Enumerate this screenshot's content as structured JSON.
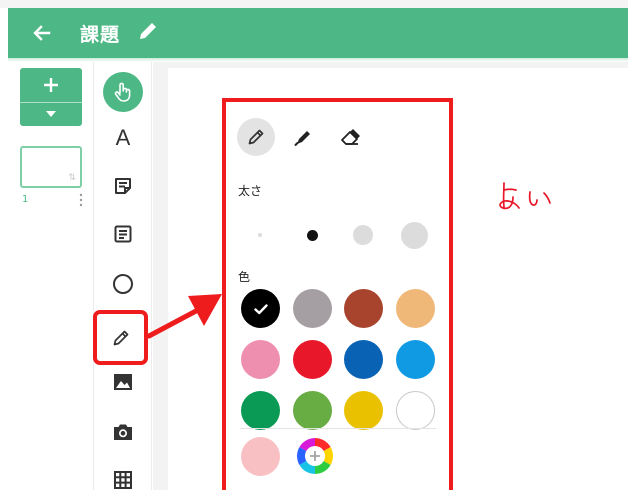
{
  "header": {
    "title": "課題",
    "back_icon": "arrow-left-icon",
    "edit_icon": "pencil-icon",
    "color": "#4db885"
  },
  "pages": {
    "add_icon": "plus-icon",
    "more_icon": "caret-down-icon",
    "items": [
      {
        "number": "1"
      }
    ]
  },
  "toolbar": {
    "tools": [
      {
        "name": "select",
        "icon": "hand-pointer-icon",
        "active": true
      },
      {
        "name": "text",
        "label": "A"
      },
      {
        "name": "sticky-note",
        "icon": "sticky-note-icon"
      },
      {
        "name": "card",
        "icon": "card-icon"
      },
      {
        "name": "shape",
        "icon": "circle-icon"
      },
      {
        "name": "pen",
        "icon": "pen-icon",
        "highlighted": true
      },
      {
        "name": "image",
        "icon": "image-icon"
      },
      {
        "name": "camera",
        "icon": "camera-icon"
      },
      {
        "name": "table",
        "icon": "table-icon"
      }
    ]
  },
  "pen_popup": {
    "pen_types": [
      {
        "name": "pen",
        "icon": "pen-icon",
        "selected": true
      },
      {
        "name": "marker",
        "icon": "marker-icon",
        "selected": false
      },
      {
        "name": "eraser",
        "icon": "eraser-icon",
        "selected": false
      }
    ],
    "thickness_label": "太さ",
    "thickness_selected": 2,
    "color_label": "色",
    "colors": [
      "#000000",
      "#a59ea3",
      "#a8432e",
      "#f0b878",
      "#ee8fb0",
      "#e8172a",
      "#0a62b4",
      "#109ae4",
      "#0a9a55",
      "#68ac44",
      "#eac100",
      "#ffffff"
    ],
    "selected_color": "#000000",
    "custom_colors": [
      "#f9c0c3"
    ],
    "add_color_icon": "color-wheel-plus-icon"
  },
  "canvas": {
    "handwriting": "よい",
    "ink_color": "#e8172a"
  },
  "annotation": {
    "color": "#ee1c1c"
  }
}
